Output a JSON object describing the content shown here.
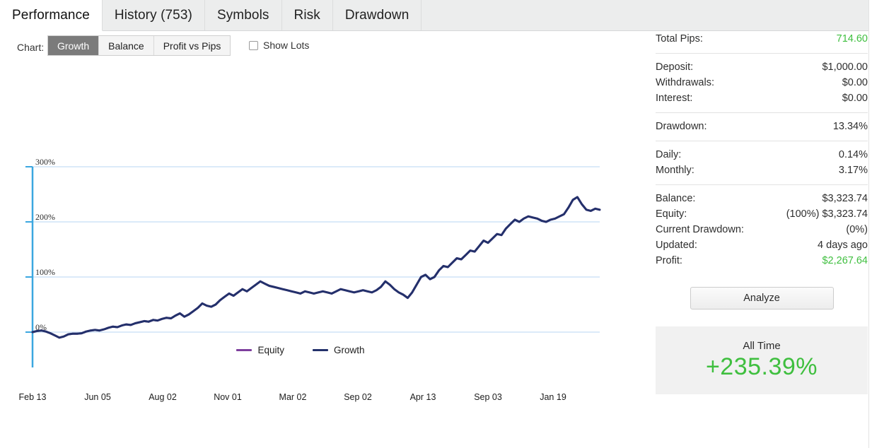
{
  "tabs": [
    {
      "label": "Performance",
      "active": true
    },
    {
      "label": "History (753)",
      "active": false
    },
    {
      "label": "Symbols",
      "active": false
    },
    {
      "label": "Risk",
      "active": false
    },
    {
      "label": "Drawdown",
      "active": false
    }
  ],
  "toolbar": {
    "chart_label": "Chart:",
    "buttons": [
      {
        "label": "Growth",
        "selected": true
      },
      {
        "label": "Balance",
        "selected": false
      },
      {
        "label": "Profit vs Pips",
        "selected": false
      }
    ],
    "show_lots_label": "Show Lots",
    "show_lots_checked": false
  },
  "chart_data": {
    "type": "line",
    "title": "",
    "xlabel": "",
    "ylabel": "",
    "ylim": [
      -40,
      300
    ],
    "yticks": [
      0,
      100,
      200,
      300
    ],
    "ytick_labels": [
      "0%",
      "100%",
      "200%",
      "300%"
    ],
    "grid": true,
    "legend_position": "bottom-center",
    "xtick_labels": [
      "Feb 13",
      "Jun 05",
      "Aug 02",
      "Nov 01",
      "Mar 02",
      "Sep 02",
      "Apr 13",
      "Sep 03",
      "Jan 19"
    ],
    "series": [
      {
        "name": "Equity",
        "color": "#7e3f9d",
        "values": [
          0,
          2,
          3,
          1,
          -2,
          -6,
          -10,
          -8,
          -4,
          -3,
          -3,
          -2,
          1,
          3,
          4,
          3,
          5,
          8,
          10,
          9,
          12,
          14,
          13,
          16,
          18,
          20,
          19,
          22,
          21,
          24,
          26,
          25,
          30,
          34,
          28,
          32,
          38,
          44,
          52,
          48,
          46,
          50,
          58,
          64,
          70,
          66,
          72,
          78,
          74,
          80,
          86,
          92,
          88,
          84,
          82,
          80,
          78,
          76,
          74,
          72,
          70,
          74,
          72,
          70,
          72,
          74,
          72,
          70,
          74,
          78,
          76,
          74,
          72,
          74,
          76,
          74,
          72,
          76,
          82,
          92,
          86,
          78,
          72,
          68,
          62,
          72,
          86,
          100,
          104,
          96,
          100,
          112,
          120,
          118,
          126,
          134,
          132,
          140,
          148,
          146,
          156,
          166,
          162,
          170,
          178,
          176,
          188,
          196,
          204,
          200,
          206,
          210,
          208,
          206,
          202,
          200,
          204,
          206,
          210,
          214,
          226,
          240,
          245,
          232,
          222,
          220,
          224,
          222
        ]
      },
      {
        "name": "Growth",
        "color": "#23316b",
        "values": [
          0,
          2,
          3,
          1,
          -2,
          -6,
          -10,
          -8,
          -4,
          -3,
          -3,
          -2,
          1,
          3,
          4,
          3,
          5,
          8,
          10,
          9,
          12,
          14,
          13,
          16,
          18,
          20,
          19,
          22,
          21,
          24,
          26,
          25,
          30,
          34,
          28,
          32,
          38,
          44,
          52,
          48,
          46,
          50,
          58,
          64,
          70,
          66,
          72,
          78,
          74,
          80,
          86,
          92,
          88,
          84,
          82,
          80,
          78,
          76,
          74,
          72,
          70,
          74,
          72,
          70,
          72,
          74,
          72,
          70,
          74,
          78,
          76,
          74,
          72,
          74,
          76,
          74,
          72,
          76,
          82,
          92,
          86,
          78,
          72,
          68,
          62,
          72,
          86,
          100,
          104,
          96,
          100,
          112,
          120,
          118,
          126,
          134,
          132,
          140,
          148,
          146,
          156,
          166,
          162,
          170,
          178,
          176,
          188,
          196,
          204,
          200,
          206,
          210,
          208,
          206,
          202,
          200,
          204,
          206,
          210,
          214,
          226,
          240,
          245,
          232,
          222,
          220,
          224,
          222
        ]
      }
    ]
  },
  "legend": [
    {
      "label": "Equity",
      "color": "#7e3f9d"
    },
    {
      "label": "Growth",
      "color": "#23316b"
    }
  ],
  "stats": {
    "total_pips": {
      "key": "Total Pips:",
      "value": "714.60"
    },
    "deposit": {
      "key": "Deposit:",
      "value": "$1,000.00"
    },
    "withdrawals": {
      "key": "Withdrawals:",
      "value": "$0.00"
    },
    "interest": {
      "key": "Interest:",
      "value": "$0.00"
    },
    "drawdown": {
      "key": "Drawdown:",
      "value": "13.34%"
    },
    "daily": {
      "key": "Daily:",
      "value": "0.14%"
    },
    "monthly": {
      "key": "Monthly:",
      "value": "3.17%"
    },
    "balance": {
      "key": "Balance:",
      "value": "$3,323.74"
    },
    "equity": {
      "key": "Equity:",
      "value": "(100%) $3,323.74"
    },
    "current_drawdown": {
      "key": "Current Drawdown:",
      "value": "(0%)"
    },
    "updated": {
      "key": "Updated:",
      "value": "4 days ago"
    },
    "profit": {
      "key": "Profit:",
      "value": "$2,267.64"
    }
  },
  "analyze_button": {
    "label": "Analyze"
  },
  "all_time": {
    "label": "All Time",
    "value": "+235.39%"
  },
  "colors": {
    "green": "#3fbf3f",
    "growth_line": "#23316b",
    "equity_line": "#7e3f9d",
    "axis": "#3ba7e0",
    "grid": "#cfe4f7"
  }
}
